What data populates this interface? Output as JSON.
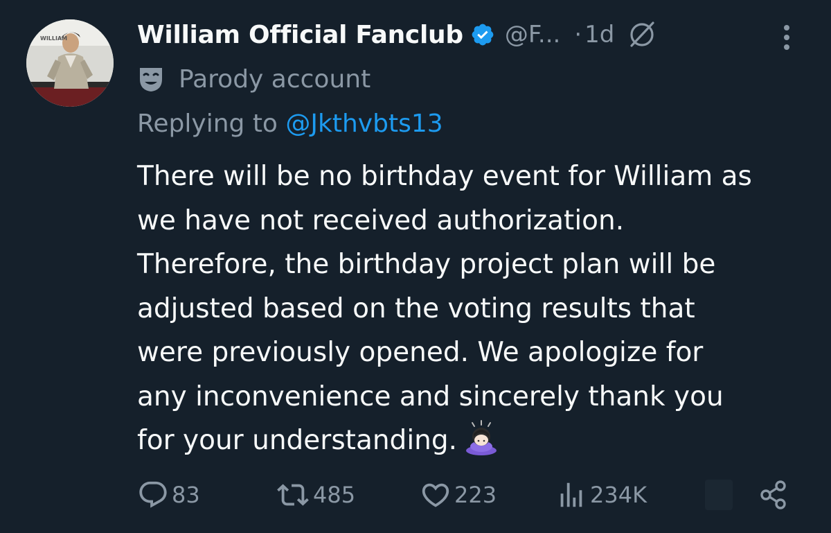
{
  "author": {
    "display_name": "William Official Fanclub",
    "handle": "@F...",
    "separator": "·",
    "time": "1d",
    "verified_color": "#1d9bf0",
    "avatar_text": "WILLIAM"
  },
  "parody": {
    "label": "Parody account",
    "icon": "theater-mask-icon"
  },
  "reply": {
    "prefix": "Replying to ",
    "handle": "@Jkthvbts13"
  },
  "body": {
    "lines": [
      "There will be no birthday event for William as",
      "we have not received authorization.",
      "Therefore, the birthday project plan will be",
      "adjusted based on the voting results that",
      "were previously opened. We apologize for",
      "any inconvenience and sincerely thank you",
      "for your understanding."
    ],
    "emoji": "🙇🏻‍♀️"
  },
  "actions": {
    "replies": "83",
    "retweets": "485",
    "likes": "223",
    "views": "234K"
  },
  "colors": {
    "background": "#15202b",
    "text": "#f7f9f9",
    "muted": "#8b98a5",
    "link": "#1d9bf0"
  }
}
